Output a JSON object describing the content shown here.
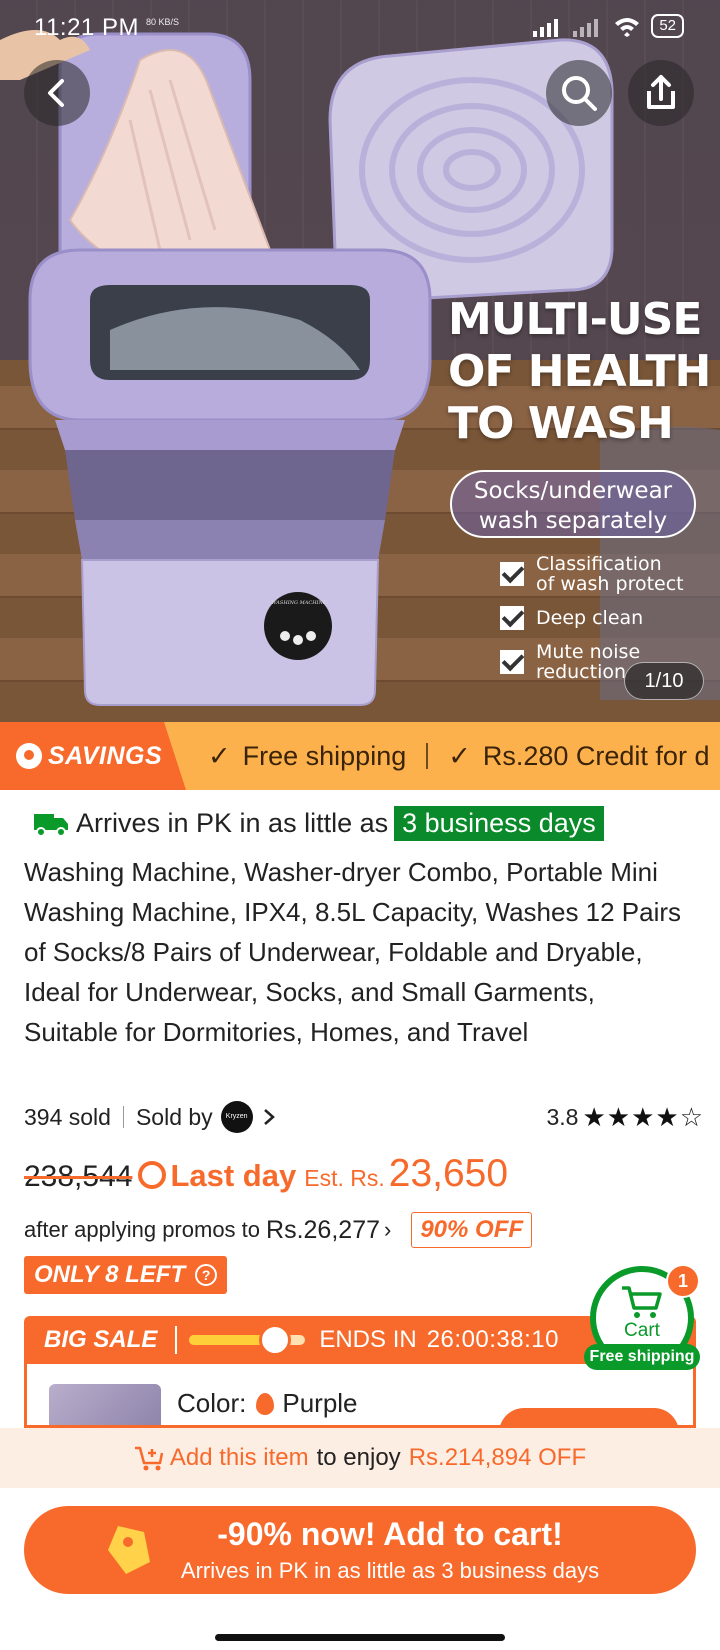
{
  "status_bar": {
    "time": "11:21 PM",
    "small_text": "80 KB/S",
    "battery": "52"
  },
  "hero": {
    "headline_lines": [
      "MULTI-USE",
      "OF HEALTH",
      "TO WASH"
    ],
    "pill_lines": [
      "Socks/underwear",
      "wash separately"
    ],
    "checks": [
      "Classification of wash protect",
      "Deep clean",
      "Mute noise reduction"
    ],
    "check_lines": [
      [
        "Classification",
        "of wash protect"
      ],
      [
        "Deep clean"
      ],
      [
        "Mute noise",
        "reduction"
      ]
    ],
    "counter": "1/10",
    "machine_label": "WASHING MACHINE"
  },
  "savings_strip": {
    "tag": "SAVINGS",
    "items": [
      "Free shipping",
      "Rs.280 Credit for d"
    ]
  },
  "delivery": {
    "prefix": "Arrives in PK in as little as",
    "badge": "3 business days"
  },
  "product": {
    "title": "Washing Machine, Washer-dryer Combo, Portable Mini Washing Machine, IPX4, 8.5L Capacity, Washes 12 Pairs of Socks/8 Pairs of Underwear, Foldable and Dryable, Ideal for Underwear, Socks, and Small Garments, Suitable for Dormitories, Homes, and Travel",
    "sold": "394 sold",
    "sold_by": "Sold by",
    "shop_logo_text": "Kryzen",
    "rating": "3.8",
    "stars_filled": 4,
    "stars_total": 5
  },
  "pricing": {
    "old_price": "238,544",
    "last_day": "Last day",
    "est_label": "Est. Rs.",
    "price": "23,650",
    "after_promos": "after applying promos to",
    "promo_price": "Rs.26,277",
    "discount_badge": "90% OFF",
    "stock": "ONLY 8 LEFT"
  },
  "big_sale": {
    "label": "BIG SALE",
    "progress": 0.74,
    "ends_in": "ENDS IN",
    "timer": "26:00:38:10"
  },
  "variant": {
    "color_label": "Color:",
    "color_value": "Purple"
  },
  "cart_float": {
    "label": "Cart",
    "shipping": "Free shipping",
    "count": "1"
  },
  "promo_banner": {
    "add_text": "Add this item",
    "mid_text": "to enjoy",
    "amount": "Rs.214,894 OFF"
  },
  "add_to_cart": {
    "line1": "-90% now! Add to cart!",
    "line2": "Arrives in PK in as little as 3 business days"
  },
  "colors": {
    "accent": "#f76a2b",
    "strip": "#fdb14c",
    "green": "#0a8a2a"
  }
}
